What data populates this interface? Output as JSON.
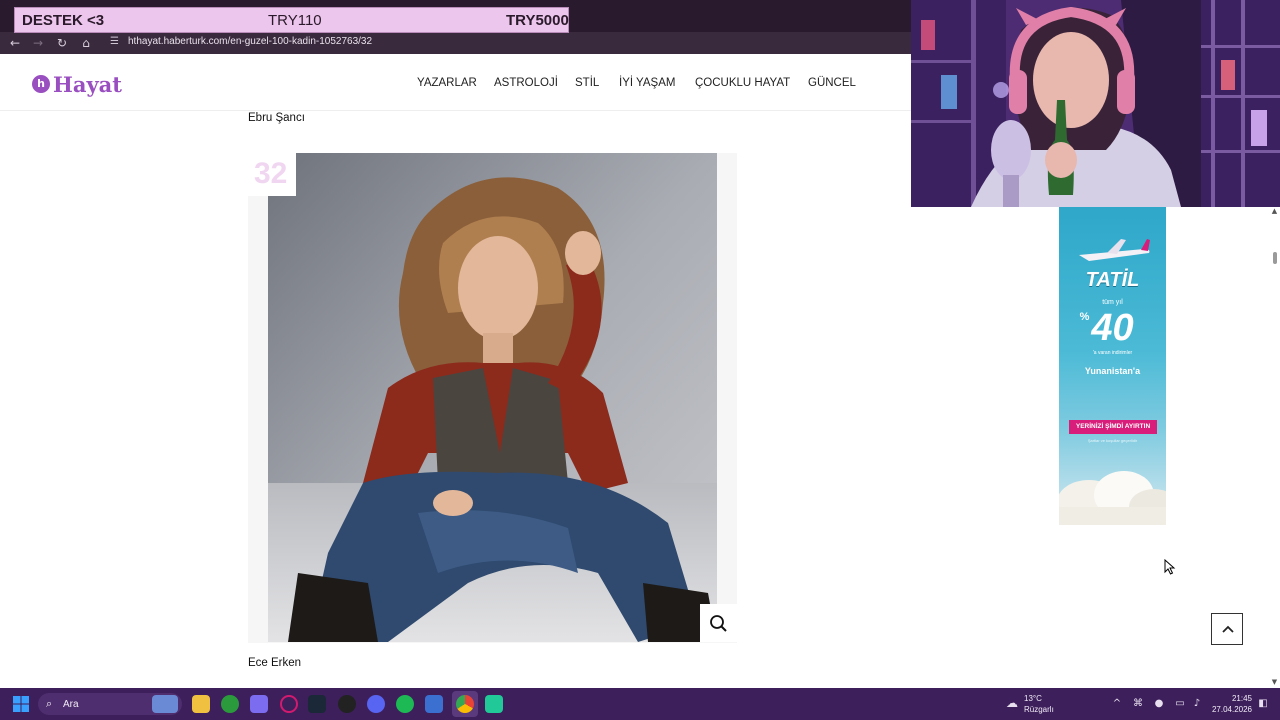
{
  "browser": {
    "url": "hthayat.haberturk.com/en-guzel-100-kadin-1052763/32"
  },
  "donation_overlay": {
    "title": "DESTEK <3",
    "current": "TRY110",
    "goal": "TRY5000"
  },
  "site": {
    "logo_text": "Hayat",
    "menu": [
      "YAZARLAR",
      "ASTROLOJİ",
      "STİL",
      "İYİ YAŞAM",
      "ÇOCUKLU HAYAT",
      "GÜNCEL"
    ]
  },
  "content": {
    "prev_caption": "Ebru Şancı",
    "item_number": "32",
    "caption": "Ece Erken"
  },
  "ad": {
    "headline": "TATİL",
    "subline": "tüm yıl",
    "percent_sign": "%",
    "discount": "40",
    "small_print": "'a varan indirimler",
    "destination": "Yunanistan'a",
    "cta": "YERİNİZİ ŞİMDİ AYIRTIN",
    "footnote": "Şartlar ve koşullar geçerlidir"
  },
  "taskbar": {
    "search_label": "Ara",
    "weather_temp": "13°C",
    "weather_desc": "Rüzgarlı",
    "time": "21:45",
    "date": "27.04.2026"
  },
  "colors": {
    "brand": "#9a4fc0",
    "taskbar": "#3d1f5c",
    "ad_cta": "#d81e7a"
  }
}
